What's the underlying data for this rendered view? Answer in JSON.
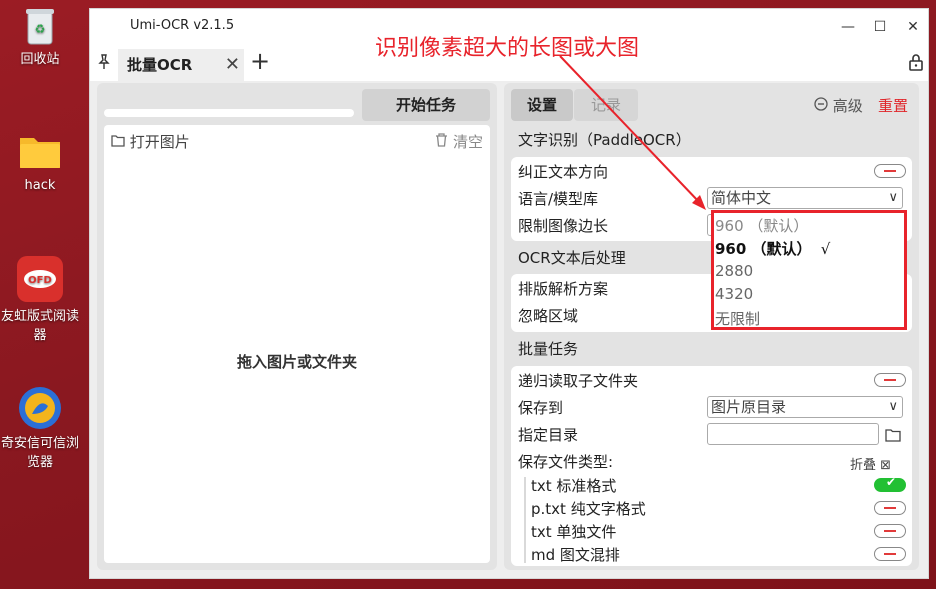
{
  "desktop": {
    "icons": [
      {
        "label": "回收站",
        "icon": "recycle-bin-icon"
      },
      {
        "label": "hack",
        "icon": "folder-icon"
      },
      {
        "label": "友虹版式阅读器",
        "icon": "reader-app-icon"
      },
      {
        "label": "奇安信可信浏览器",
        "icon": "browser-app-icon"
      }
    ]
  },
  "window": {
    "title": "Umi-OCR v2.1.5",
    "controls": {
      "minimize": "—",
      "maximize": "☐",
      "close": "✕"
    }
  },
  "tabs": {
    "active_label": "批量OCR",
    "close_glyph": "✕",
    "add_glyph": "+"
  },
  "left_panel": {
    "start_button": "开始任务",
    "open_image": "打开图片",
    "clear": "清空",
    "drop_hint": "拖入图片或文件夹"
  },
  "right_panel": {
    "tab_settings": "设置",
    "tab_record": "记录",
    "advanced": "高级",
    "reset": "重置",
    "ocr_section": {
      "title": "文字识别（PaddleOCR）",
      "rows": [
        {
          "label": "纠正文本方向"
        },
        {
          "label": "语言/模型库",
          "value": "简体中文"
        },
        {
          "label": "限制图像边长",
          "value": "960 （默认）"
        }
      ]
    },
    "post_section": {
      "title": "OCR文本后处理",
      "rows": [
        {
          "label": "排版解析方案"
        },
        {
          "label": "忽略区域"
        }
      ]
    },
    "batch_section": {
      "title": "批量任务",
      "rows": [
        {
          "label": "递归读取子文件夹"
        },
        {
          "label": "保存到",
          "value": "图片原目录"
        },
        {
          "label": "指定目录",
          "value": ""
        },
        {
          "label": "保存文件类型:",
          "extra": "折叠"
        }
      ],
      "file_types": [
        {
          "label": "txt 标准格式",
          "enabled": true
        },
        {
          "label": "p.txt 纯文字格式",
          "enabled": false
        },
        {
          "label": "txt 单独文件",
          "enabled": false
        },
        {
          "label": "md 图文混排",
          "enabled": false
        }
      ]
    }
  },
  "dropdown": {
    "options": [
      "960 （默认）",
      "2880",
      "4320",
      "无限制"
    ],
    "selected_mark": "√"
  },
  "annotation": {
    "text": "识别像素超大的长图或大图",
    "color": "#e8232b"
  }
}
